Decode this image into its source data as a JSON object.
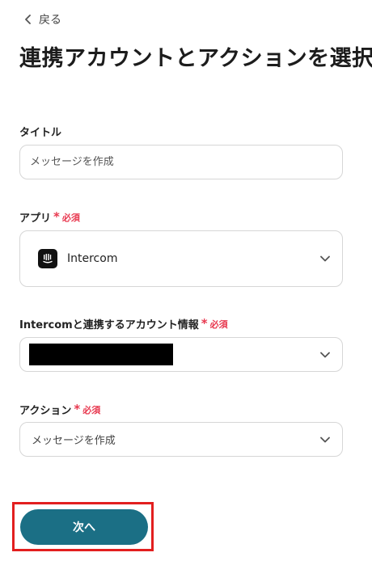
{
  "header": {
    "back_label": "戻る",
    "title": "連携アカウントとアクションを選択"
  },
  "form": {
    "title_field": {
      "label": "タイトル",
      "placeholder": "メッセージを作成"
    },
    "app_field": {
      "label": "アプリ",
      "required_mark": "*",
      "required_text": "必須",
      "value": "Intercom",
      "icon": "intercom-logo-icon"
    },
    "account_field": {
      "label": "Intercomと連携するアカウント情報",
      "required_mark": "*",
      "required_text": "必須"
    },
    "action_field": {
      "label": "アクション",
      "required_mark": "*",
      "required_text": "必須",
      "value": "メッセージを作成"
    }
  },
  "footer": {
    "next_label": "次へ"
  },
  "colors": {
    "accent": "#1b6f85",
    "required": "#e8384f",
    "highlight_border": "#e21f1f"
  }
}
